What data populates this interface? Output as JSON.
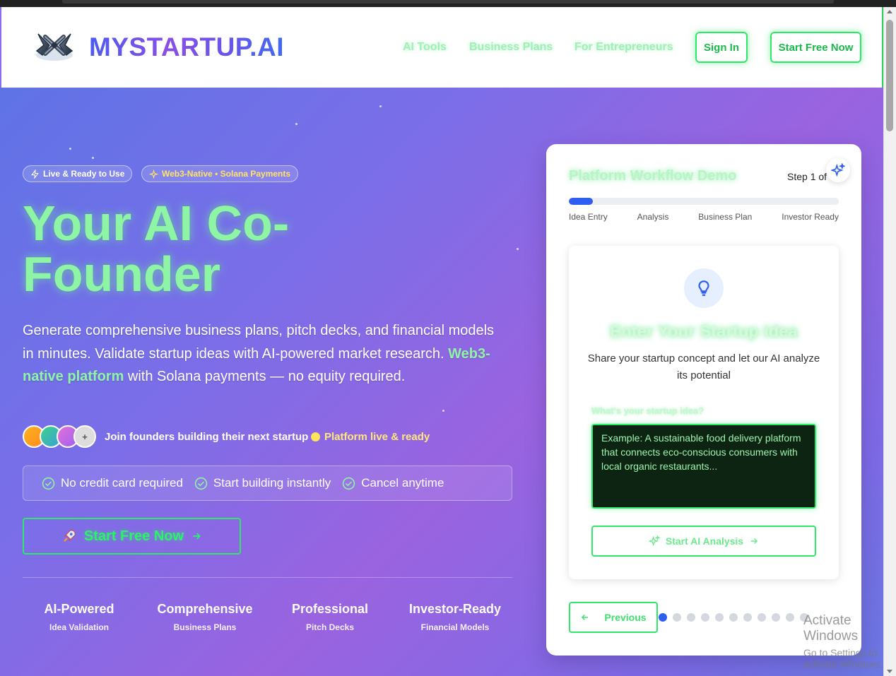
{
  "header": {
    "brand": "MYSTARTUP.AI",
    "nav": [
      "AI Tools",
      "Business Plans",
      "For Entrepreneurs"
    ],
    "sign_in": "Sign In",
    "start_free": "Start Free Now"
  },
  "hero": {
    "badge_live": "Live & Ready to Use",
    "badge_web3": "Web3-Native • Solana Payments",
    "title": "Your AI Co-Founder",
    "desc_part1": "Generate comprehensive business plans, pitch decks, and financial models in minutes. Validate startup ideas with AI-powered market research. ",
    "desc_highlight": "Web3-native platform",
    "desc_part2": " with Solana payments — no equity required.",
    "join_text": "Join founders building their next startup",
    "avatar_more": "+",
    "live_text": "Platform live & ready",
    "checks": [
      "No credit card required",
      "Start building instantly",
      "Cancel anytime"
    ],
    "cta": "Start Free Now",
    "stats": [
      {
        "title": "AI-Powered",
        "sub": "Idea Validation"
      },
      {
        "title": "Comprehensive",
        "sub": "Business Plans"
      },
      {
        "title": "Professional",
        "sub": "Pitch Decks"
      },
      {
        "title": "Investor-Ready",
        "sub": "Financial Models"
      }
    ]
  },
  "demo": {
    "title": "Platform Workflow Demo",
    "step_text": "Step 1 of",
    "progress": 0.09,
    "steps": [
      "Idea Entry",
      "Analysis",
      "Business Plan",
      "Investor Ready"
    ],
    "card_title": "Enter Your Startup Idea",
    "card_desc": "Share your startup concept and let our AI analyze its potential",
    "idea_label": "What's your startup idea?",
    "idea_placeholder": "Example: A sustainable food delivery platform that connects eco-conscious consumers with local organic restaurants...",
    "analysis_button": "Start AI Analysis",
    "previous": "Previous",
    "dot_count": 11,
    "active_dot": 0
  },
  "watermark": {
    "line1": "Activate Windows",
    "line2": "Go to Settings to activate Windows."
  },
  "colors": {
    "accent_green": "#2ee86a",
    "brand_blue": "#4b5cf0",
    "brand_purple": "#8a4ee6",
    "progress_blue": "#2f5ff0"
  }
}
